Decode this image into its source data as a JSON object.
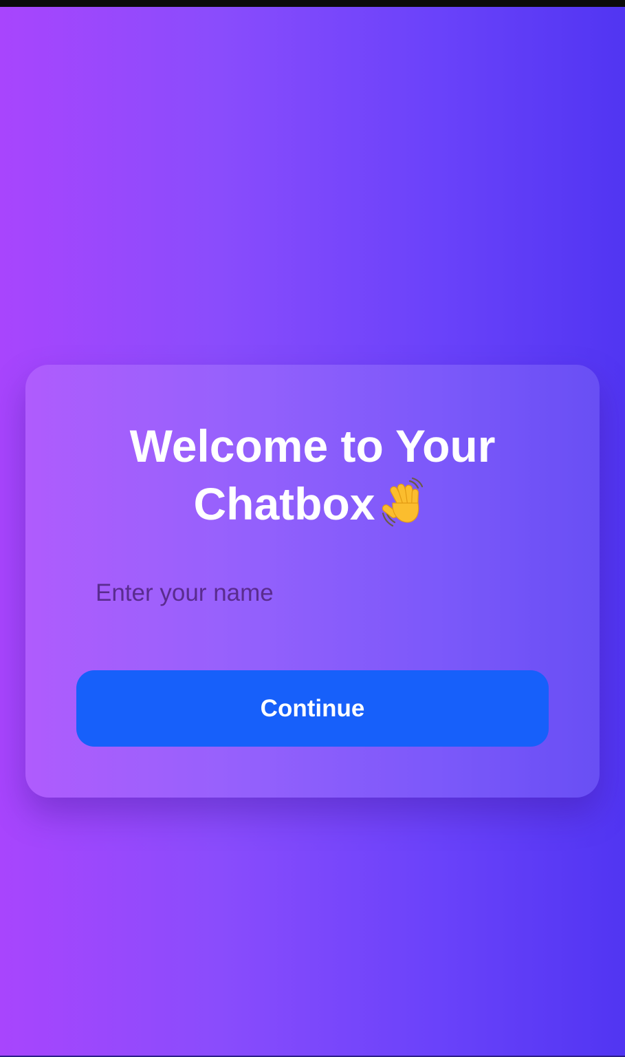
{
  "welcome": {
    "title_line1": "Welcome to Your",
    "title_line2": "Chatbox",
    "title_icon": "waving-hand-icon"
  },
  "form": {
    "name_value": "",
    "name_placeholder": "Enter your name",
    "continue_label": "Continue"
  },
  "colors": {
    "background_start": "#a845fd",
    "background_end": "#5135f2",
    "button": "#1760fa",
    "text": "#ffffff",
    "placeholder": "#5a2c8f"
  }
}
